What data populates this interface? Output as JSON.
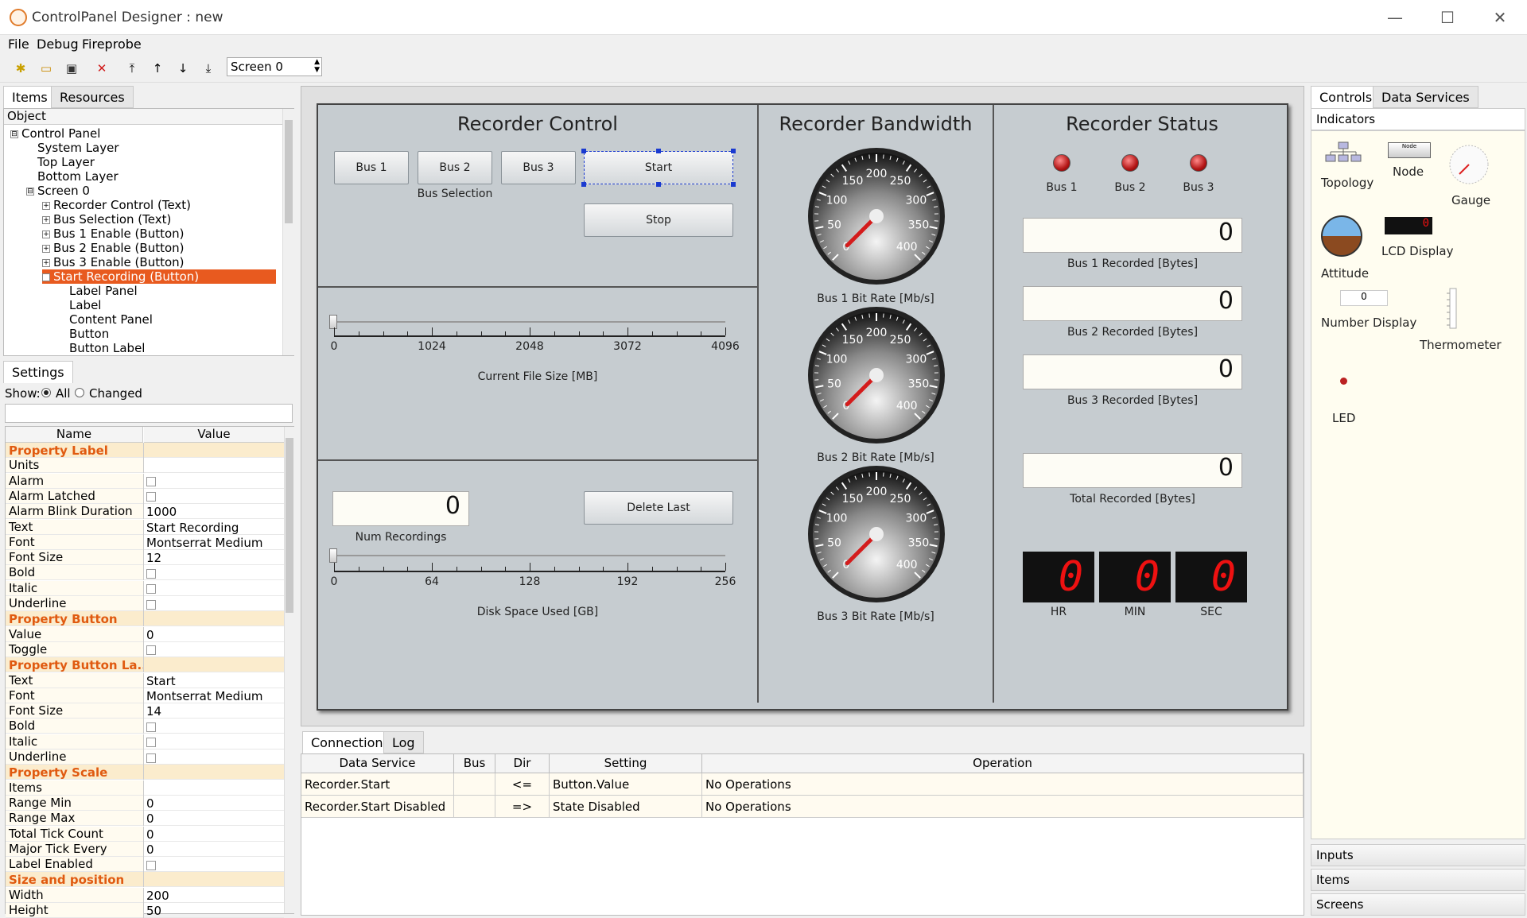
{
  "window": {
    "title": "ControlPanel Designer : new",
    "minimize": "—",
    "maximize": "☐",
    "close": "✕"
  },
  "menu": [
    "File",
    "Debug",
    "Fireprobe"
  ],
  "toolbar": {
    "screen_select": "Screen 0"
  },
  "left_tabs": [
    "Items",
    "Resources"
  ],
  "tree": {
    "header": "Object",
    "rows": [
      {
        "label": "Control Panel",
        "indent": 0,
        "expander": "⊟"
      },
      {
        "label": "System Layer",
        "indent": 1,
        "expander": ""
      },
      {
        "label": "Top Layer",
        "indent": 1,
        "expander": ""
      },
      {
        "label": "Bottom Layer",
        "indent": 1,
        "expander": ""
      },
      {
        "label": "Screen 0",
        "indent": 1,
        "expander": "⊟"
      },
      {
        "label": "Recorder Control (Text)",
        "indent": 2,
        "expander": "+"
      },
      {
        "label": "Bus Selection (Text)",
        "indent": 2,
        "expander": "+"
      },
      {
        "label": "Bus 1 Enable (Button)",
        "indent": 2,
        "expander": "+"
      },
      {
        "label": "Bus 2 Enable (Button)",
        "indent": 2,
        "expander": "+"
      },
      {
        "label": "Bus 3 Enable (Button)",
        "indent": 2,
        "expander": "+"
      },
      {
        "label": "Start Recording (Button)",
        "indent": 2,
        "expander": "−",
        "selected": true
      },
      {
        "label": "Label Panel",
        "indent": 3,
        "expander": ""
      },
      {
        "label": "Label",
        "indent": 3,
        "expander": ""
      },
      {
        "label": "Content Panel",
        "indent": 3,
        "expander": ""
      },
      {
        "label": "Button",
        "indent": 3,
        "expander": ""
      },
      {
        "label": "Button Label",
        "indent": 3,
        "expander": ""
      }
    ]
  },
  "settings": {
    "tab": "Settings",
    "show_label": "Show:",
    "show_all": "All",
    "show_changed": "Changed",
    "col_name": "Name",
    "col_value": "Value",
    "rows": [
      {
        "type": "cat",
        "name": "Property Label"
      },
      {
        "name": "Units",
        "value": ""
      },
      {
        "name": "Alarm",
        "checkbox": true
      },
      {
        "name": "Alarm Latched",
        "checkbox": true
      },
      {
        "name": "Alarm Blink Duration",
        "value": "1000"
      },
      {
        "name": "Text",
        "value": "Start Recording"
      },
      {
        "name": "Font",
        "value": "Montserrat Medium"
      },
      {
        "name": "Font Size",
        "value": "12"
      },
      {
        "name": "Bold",
        "checkbox": true
      },
      {
        "name": "Italic",
        "checkbox": true
      },
      {
        "name": "Underline",
        "checkbox": true
      },
      {
        "type": "cat",
        "name": "Property Button"
      },
      {
        "name": "Value",
        "value": "0"
      },
      {
        "name": "Toggle",
        "checkbox": true
      },
      {
        "type": "cat",
        "name": "Property Button La..."
      },
      {
        "name": "Text",
        "value": "Start"
      },
      {
        "name": "Font",
        "value": "Montserrat Medium"
      },
      {
        "name": "Font Size",
        "value": "14"
      },
      {
        "name": "Bold",
        "checkbox": true
      },
      {
        "name": "Italic",
        "checkbox": true
      },
      {
        "name": "Underline",
        "checkbox": true
      },
      {
        "type": "cat",
        "name": "Property Scale"
      },
      {
        "name": "Items",
        "value": ""
      },
      {
        "name": "Range Min",
        "value": "0"
      },
      {
        "name": "Range Max",
        "value": "0"
      },
      {
        "name": "Total Tick Count",
        "value": "0"
      },
      {
        "name": "Major Tick Every",
        "value": "0"
      },
      {
        "name": "Label Enabled",
        "checkbox": true
      },
      {
        "type": "cat",
        "name": "Size and position"
      },
      {
        "name": "Width",
        "value": "200"
      },
      {
        "name": "Height",
        "value": "50"
      }
    ]
  },
  "recorder_control": {
    "title": "Recorder Control",
    "bus1": "Bus 1",
    "bus2": "Bus 2",
    "bus3": "Bus 3",
    "bus_selection": "Bus Selection",
    "start": "Start",
    "stop": "Stop",
    "file_size_label": "Current File Size [MB]",
    "file_size_ticks": [
      "0",
      "1024",
      "2048",
      "3072",
      "4096"
    ],
    "num_recordings": "0",
    "num_recordings_label": "Num Recordings",
    "delete_last": "Delete Last",
    "disk_label": "Disk Space Used [GB]",
    "disk_ticks": [
      "0",
      "64",
      "128",
      "192",
      "256"
    ]
  },
  "bandwidth": {
    "title": "Recorder Bandwidth",
    "gauge_ticks": [
      "0",
      "50",
      "100",
      "150",
      "200",
      "250",
      "300",
      "350",
      "400"
    ],
    "gauges": [
      {
        "label": "Bus 1 Bit Rate [Mb/s]",
        "value": 0
      },
      {
        "label": "Bus 2 Bit Rate [Mb/s]",
        "value": 0
      },
      {
        "label": "Bus 3 Bit Rate [Mb/s]",
        "value": 0
      }
    ]
  },
  "status": {
    "title": "Recorder Status",
    "leds": [
      "Bus 1",
      "Bus 2",
      "Bus 3"
    ],
    "bus1_rec": "0",
    "bus1_label": "Bus 1 Recorded  [Bytes]",
    "bus2_rec": "0",
    "bus2_label": "Bus 2 Recorded  [Bytes]",
    "bus3_rec": "0",
    "bus3_label": "Bus 3 Recorded  [Bytes]",
    "total_rec": "0",
    "total_label": "Total Recorded  [Bytes]",
    "hr": "0",
    "min": "0",
    "sec": "0",
    "hr_label": "HR",
    "min_label": "MIN",
    "sec_label": "SEC"
  },
  "bottom_tabs": [
    "Connections",
    "Log"
  ],
  "connections": {
    "headers": [
      "Data Service",
      "Bus",
      "Dir",
      "Setting",
      "Operation"
    ],
    "rows": [
      [
        "Recorder.Start",
        "",
        "<=",
        "Button.Value",
        "No Operations"
      ],
      [
        "Recorder.Start Disabled",
        "",
        "=>",
        "State Disabled",
        "No Operations"
      ]
    ]
  },
  "right_tabs": [
    "Controls",
    "Data Services"
  ],
  "indicators": {
    "header": "Indicators",
    "items": [
      "Topology",
      "Node",
      "Gauge",
      "Attitude",
      "LCD Display",
      "Number Display",
      "Thermometer",
      "LED"
    ],
    "node_small": "Node",
    "number_display_value": "0",
    "lcd_value": "0"
  },
  "accordion": [
    "Inputs",
    "Items",
    "Screens"
  ]
}
